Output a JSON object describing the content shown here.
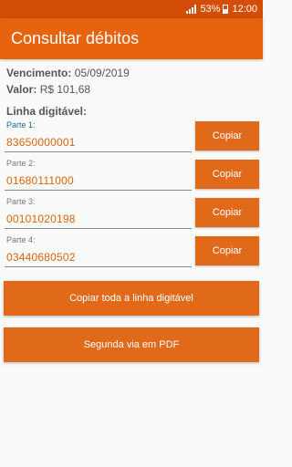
{
  "status_bar": {
    "battery": "53%",
    "time": "12:00"
  },
  "app_bar": {
    "title": "Consultar débitos"
  },
  "info": {
    "due_label": "Vencimento:",
    "due_value": "05/09/2019",
    "amount_label": "Valor:",
    "amount_value": "R$ 101,68"
  },
  "digitable": {
    "title": "Linha digitável:",
    "parts": [
      {
        "label": "Parte 1:",
        "value": "83650000001",
        "button": "Copiar"
      },
      {
        "label": "Parte 2:",
        "value": "01680111000",
        "button": "Copiar"
      },
      {
        "label": "Parte 3:",
        "value": "00101020198",
        "button": "Copiar"
      },
      {
        "label": "Parte 4:",
        "value": "03440680502",
        "button": "Copiar"
      }
    ]
  },
  "actions": {
    "copy_all": "Copiar toda a linha digitável",
    "pdf": "Segunda via em PDF"
  },
  "colors": {
    "primary": "#e8630e",
    "primary_dark": "#d24e06",
    "accent_text": "#d9640e"
  }
}
